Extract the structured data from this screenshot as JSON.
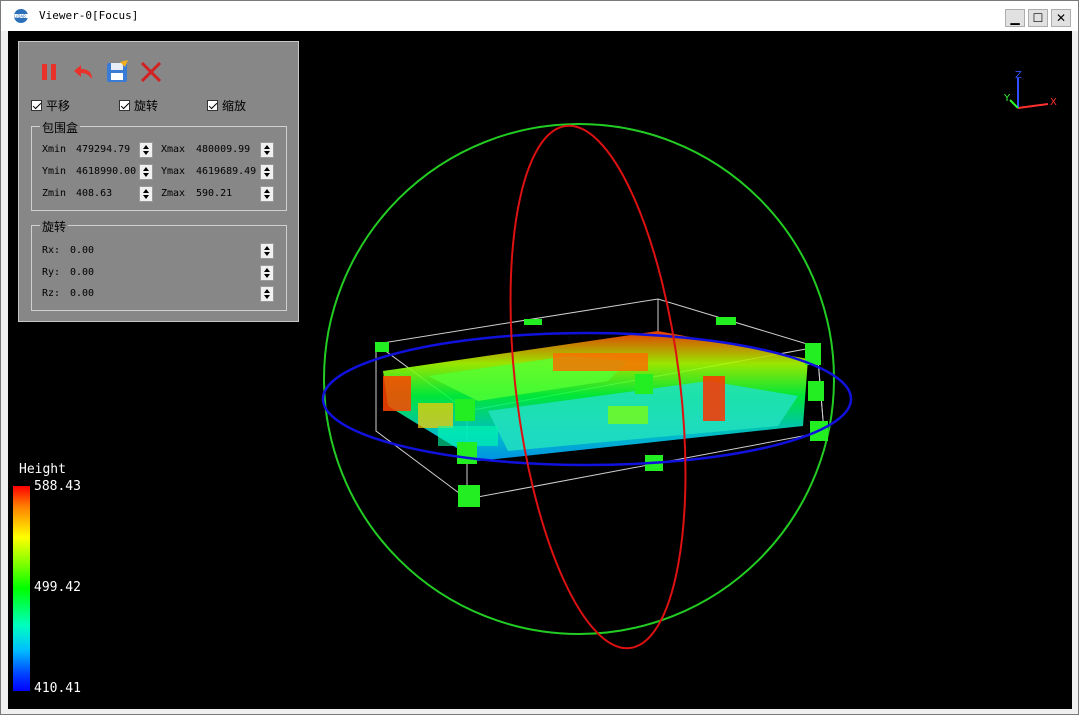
{
  "window": {
    "title": "Viewer-0[Focus]",
    "logo": "lidar-logo",
    "controls": {
      "minimize": "▁",
      "maximize": "☐",
      "close": "✕"
    }
  },
  "toolbar": {
    "tools": [
      {
        "name": "pause",
        "icon": "pause-icon",
        "color": "#e8322a"
      },
      {
        "name": "undo",
        "icon": "undo-icon",
        "color": "#e8322a"
      },
      {
        "name": "save",
        "icon": "save-icon",
        "color": "#3a7bd5"
      },
      {
        "name": "close",
        "icon": "close-icon",
        "color": "#d42020"
      }
    ]
  },
  "options": {
    "pan": "平移",
    "rotate": "旋转",
    "zoom": "缩放"
  },
  "bbox": {
    "title": "包围盒",
    "xmin_label": "Xmin",
    "xmin": "479294.79",
    "xmax_label": "Xmax",
    "xmax": "480009.99",
    "ymin_label": "Ymin",
    "ymin": "4618990.00",
    "ymax_label": "Ymax",
    "ymax": "4619689.49",
    "zmin_label": "Zmin",
    "zmin": "408.63",
    "zmax_label": "Zmax",
    "zmax": "590.21"
  },
  "rotation": {
    "title": "旋转",
    "rx_label": "Rx:",
    "rx": "0.00",
    "ry_label": "Ry:",
    "ry": "0.00",
    "rz_label": "Rz:",
    "rz": "0.00"
  },
  "legend": {
    "title": "Height",
    "max": "588.43",
    "mid": "499.42",
    "min": "410.41",
    "colors": [
      "#ff0000",
      "#ffff00",
      "#00ff00",
      "#00bfff",
      "#0000ff"
    ]
  },
  "axes": {
    "x": "X",
    "y": "Y",
    "z": "Z"
  },
  "gizmo": {
    "sphere_color": "#22cc22",
    "vertical_ring_color": "#dd1111",
    "horizontal_ring_color": "#1111dd"
  }
}
